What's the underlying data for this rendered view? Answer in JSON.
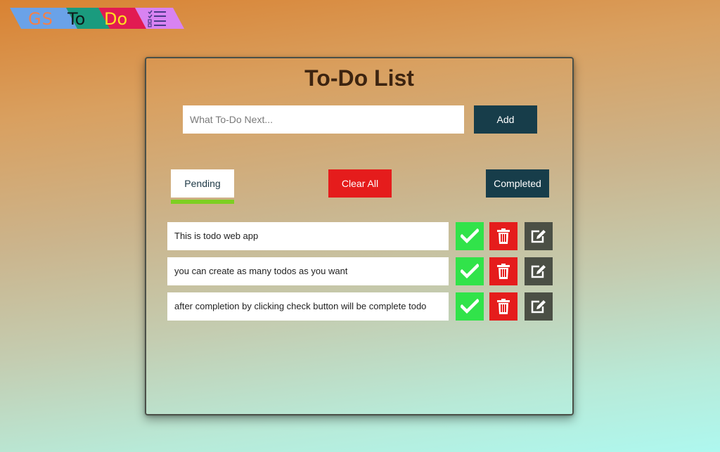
{
  "logo": {
    "part1": "GS",
    "part2": "To",
    "part3": "Do",
    "icon": "checklist-icon",
    "colors": [
      "#6aa2e8",
      "#1a9b7e",
      "#e21a52",
      "#d883f2"
    ]
  },
  "app": {
    "title": "To-Do List",
    "input_placeholder": "What To-Do Next...",
    "add_label": "Add"
  },
  "filters": {
    "pending_label": "Pending",
    "clear_label": "Clear All",
    "completed_label": "Completed",
    "active": "pending",
    "active_color": "#7ecf22"
  },
  "todos": [
    {
      "text": "This is todo web app"
    },
    {
      "text": "you can create as many todos as you want"
    },
    {
      "text": "after completion by clicking check button will be complete todo"
    }
  ],
  "row_actions": {
    "complete_icon": "check-icon",
    "delete_icon": "trash-icon",
    "edit_icon": "edit-icon",
    "colors": {
      "complete": "#31e34a",
      "delete": "#e51c1c",
      "edit": "#4b4f45"
    }
  }
}
